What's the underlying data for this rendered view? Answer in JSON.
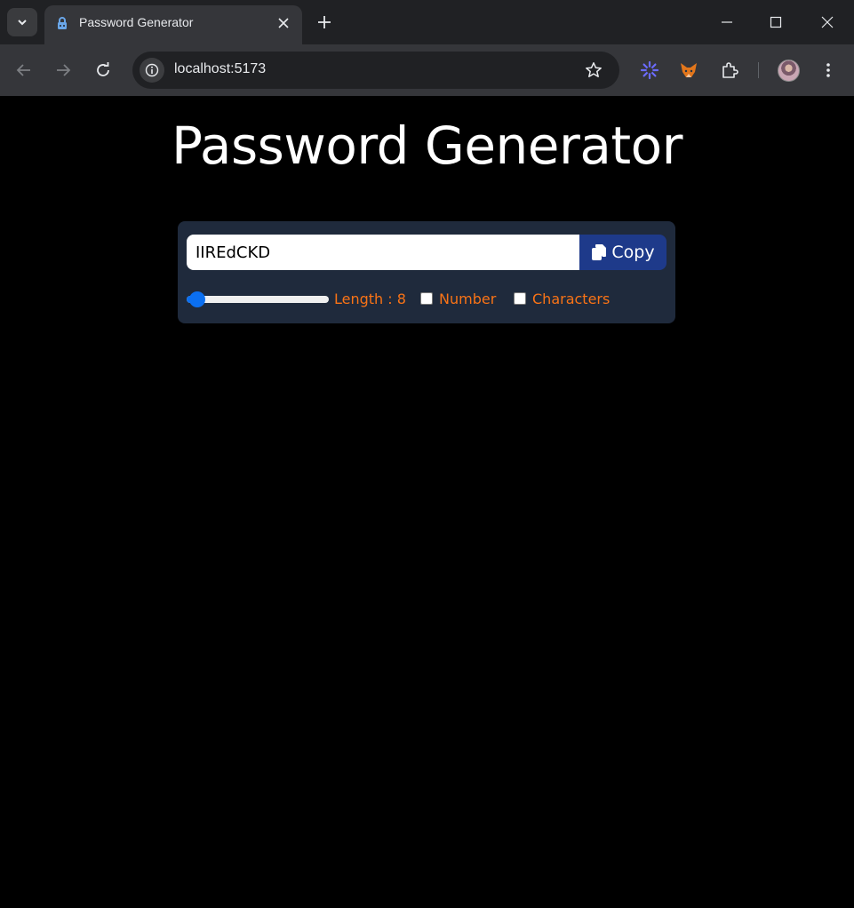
{
  "browser": {
    "tab_title": "Password Generator",
    "url": "localhost:5173"
  },
  "page": {
    "title": "Password Generator",
    "password_value": "IIREdCKD",
    "copy_label": "Copy",
    "length_label": "Length : 8",
    "length_value": 8,
    "length_min": 6,
    "length_max": 100,
    "number_label": "Number",
    "number_checked": false,
    "characters_label": "Characters",
    "characters_checked": false
  },
  "colors": {
    "page_background": "#000000",
    "card_background": "#1f2a3c",
    "accent_orange": "#f97316",
    "copy_button": "#1e3a8a",
    "slider_blue": "#0b6ff0"
  }
}
